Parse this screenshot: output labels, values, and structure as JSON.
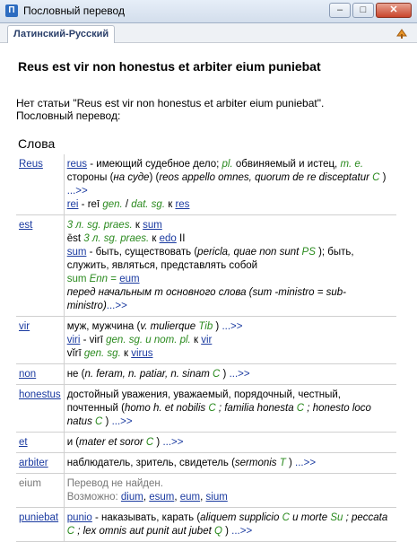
{
  "window": {
    "title": "Пословный перевод",
    "min": "–",
    "max": "□",
    "close": "✕",
    "app_icon": "book-icon"
  },
  "tab": {
    "label": "Латинский-Русский",
    "action_icon": "speak-icon"
  },
  "heading": "Reus est vir non honestus et arbiter eium puniebat",
  "message_line1": "Нет статьи \"Reus est vir non honestus et arbiter eium puniebat\".",
  "message_line2": "Пословный перевод:",
  "section_title": "Слова",
  "more": "...>>",
  "rows": {
    "reus": {
      "word": "Reus",
      "l1_link": "reus",
      "l1_a": " - имеющий судебное дело; ",
      "l1_pl": "pl.",
      "l1_b": " обвиняемый и истец, ",
      "l1_me": "m. e.",
      "l1_c": " стороны (",
      "l1_it": "на суде",
      "l1_d": ") (",
      "l1_q": "reos appello omnes, quorum de re disceptatur",
      "l1_C": "C",
      "l1_e": " ) ",
      "l2_link": "rei",
      "l2_a": " - reī ",
      "l2_gen": "gen.",
      "l2_b": " / ",
      "l2_dat": "dat. sg.",
      "l2_c": " к ",
      "l2_link2": "res"
    },
    "est": {
      "word": "est",
      "l1_g": "3 л. sg. praes.",
      "l1_k": " к ",
      "l1_link": "sum",
      "l2_a": "ēst ",
      "l2_g": "3 л. sg. praes.",
      "l2_k": " к ",
      "l2_link": "edo",
      "l2_b": " II",
      "l3_link": "sum",
      "l3_a": " - быть, существовать (",
      "l3_q": "pericla, quae non sunt",
      "l3_ps": "PS",
      "l3_b": " ); быть, служить, являться, представлять собой",
      "l4_a": "sum ",
      "l4_g": "Enn",
      "l4_b": " = ",
      "l4_link": "eum",
      "l5": "перед начальным m основного слова (sum -ministro = sub-ministro)"
    },
    "vir": {
      "word": "vir",
      "l1_a": "муж, мужчина (",
      "l1_q": "v. mulierque",
      "l1_tib": "Tib",
      "l1_b": " ) ",
      "l2_link": "viri",
      "l2_a": " - virī ",
      "l2_g": "gen. sg. и nom. pl.",
      "l2_k": " к ",
      "l2_link2": "vir",
      "l3_a": "vĭrī ",
      "l3_g": "gen. sg.",
      "l3_k": " к ",
      "l3_link": "virus"
    },
    "non": {
      "word": "non",
      "a": "не (",
      "q": "n. feram, n. patiar, n. sinam",
      "C": "C",
      "b": " ) "
    },
    "honestus": {
      "word": "honestus",
      "a": "достойный уважения, уважаемый, порядочный, честный, почтенный (",
      "q1": "homo h. et nobilis",
      "C1": "C",
      "q2": " ; familia honesta ",
      "C2": "C",
      "q3": " ; honesto loco natus ",
      "C3": "C",
      "b": " ) "
    },
    "et": {
      "word": "et",
      "a": "и (",
      "q": "mater et soror",
      "C": "C",
      "b": " ) "
    },
    "arbiter": {
      "word": "arbiter",
      "a": "наблюдатель, зритель, свидетель (",
      "q": "sermonis",
      "T": "T",
      "b": " ) "
    },
    "eium": {
      "word": "eium",
      "l1": "Перевод не найден.",
      "l2": "Возможно: ",
      "s1": "dium",
      "s2": "esum",
      "s3": "eum",
      "s4": "sium"
    },
    "puniebat": {
      "word": "puniebat",
      "link": "punio",
      "a": " - наказывать, карать (",
      "q1": "aliquem supplicio",
      "C1": "C",
      "q2": " и ",
      "q3": "morte",
      "Su": "Su",
      "q4": " ; peccata ",
      "C2": "C",
      "q5": " ; lex omnis aut punit aut jubet ",
      "Q": "Q",
      "b": " ) "
    }
  }
}
